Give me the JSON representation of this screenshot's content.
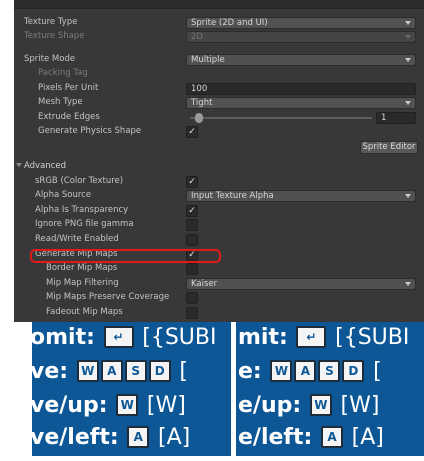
{
  "inspector": {
    "texture_type": {
      "label": "Texture Type",
      "value": "Sprite (2D and UI)"
    },
    "texture_shape": {
      "label": "Texture Shape",
      "value": "2D"
    },
    "sprite_mode": {
      "label": "Sprite Mode",
      "value": "Multiple"
    },
    "packing_tag": {
      "label": "Packing Tag"
    },
    "pixels_per_unit": {
      "label": "Pixels Per Unit",
      "value": "100"
    },
    "mesh_type": {
      "label": "Mesh Type",
      "value": "Tight"
    },
    "extrude_edges": {
      "label": "Extrude Edges",
      "value": "1",
      "fraction": 0.01
    },
    "generate_physics_shape": {
      "label": "Generate Physics Shape",
      "checked": "✓"
    },
    "sprite_editor_button": "Sprite Editor",
    "advanced": {
      "label": "Advanced"
    },
    "srgb": {
      "label": "sRGB (Color Texture)",
      "checked": "✓"
    },
    "alpha_source": {
      "label": "Alpha Source",
      "value": "Input Texture Alpha"
    },
    "alpha_is_transparency": {
      "label": "Alpha Is Transparency",
      "checked": "✓"
    },
    "ignore_png_gamma": {
      "label": "Ignore PNG file gamma",
      "checked": ""
    },
    "read_write_enabled": {
      "label": "Read/Write Enabled",
      "checked": ""
    },
    "generate_mip_maps": {
      "label": "Generate Mip Maps",
      "checked": "✓"
    },
    "border_mip_maps": {
      "label": "Border Mip Maps",
      "checked": ""
    },
    "mip_map_filtering": {
      "label": "Mip Map Filtering",
      "value": "Kaiser"
    },
    "mip_maps_preserve_coverage": {
      "label": "Mip Maps Preserve Coverage",
      "checked": ""
    },
    "fadeout_mip_maps": {
      "label": "Fadeout Mip Maps",
      "checked": ""
    },
    "highlight_color": "#e01919"
  },
  "preview_left": {
    "line1": {
      "text": "omit:",
      "key": "↵",
      "tail": "[{SUBI"
    },
    "line2": {
      "text": "ve:",
      "keys": [
        "W",
        "A",
        "S",
        "D"
      ],
      "tail": "["
    },
    "line3": {
      "text": "ve/up:",
      "key": "W",
      "tail": "[W]"
    },
    "line4": {
      "text": "ve/left:",
      "key": "A",
      "tail": "[A]"
    }
  },
  "preview_right": {
    "line1": {
      "text": "mit:",
      "key": "↵",
      "tail": "[{SUBI"
    },
    "line2": {
      "text": "e:",
      "keys": [
        "W",
        "A",
        "S",
        "D"
      ],
      "tail": "["
    },
    "line3": {
      "text": "e/up:",
      "key": "W",
      "tail": "[W]"
    },
    "line4": {
      "text": "e/left:",
      "key": "A",
      "tail": "[A]"
    }
  },
  "colors": {
    "inspector_bg": "#383838",
    "panel_bg": "#0e5796"
  }
}
